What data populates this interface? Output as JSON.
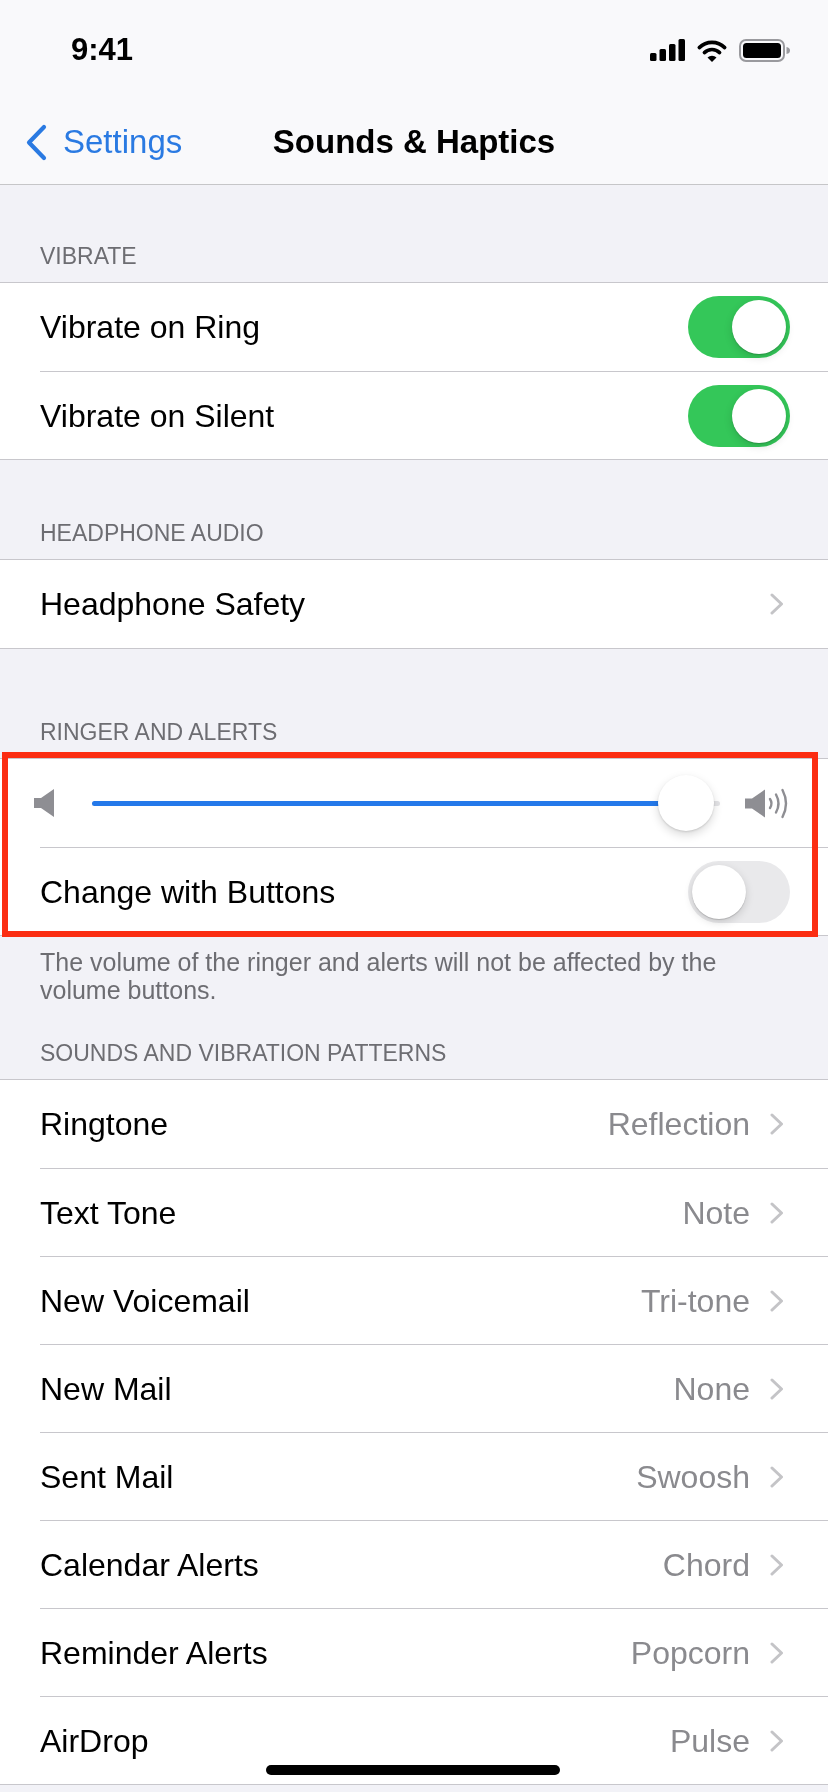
{
  "status_bar": {
    "time": "9:41"
  },
  "nav_bar": {
    "back": "Settings",
    "title": "Sounds & Haptics"
  },
  "sections": [
    {
      "header": "VIBRATE",
      "highlighted": false,
      "rows": [
        {
          "kind": "toggle",
          "label": "Vibrate on Ring",
          "on": true
        },
        {
          "kind": "toggle",
          "label": "Vibrate on Silent",
          "on": true
        }
      ]
    },
    {
      "header": "HEADPHONE AUDIO",
      "highlighted": false,
      "rows": [
        {
          "kind": "link",
          "label": "Headphone Safety"
        }
      ]
    },
    {
      "header": "RINGER AND ALERTS",
      "highlighted": true,
      "rows": [
        {
          "kind": "slider",
          "level": 0.99
        },
        {
          "kind": "toggle",
          "label": "Change with Buttons",
          "on": false
        }
      ],
      "footer": "The volume of the ringer and alerts will not be affected by the volume buttons."
    },
    {
      "header": "SOUNDS AND VIBRATION PATTERNS",
      "highlighted": false,
      "rows": [
        {
          "kind": "link",
          "label": "Ringtone",
          "value": "Reflection"
        },
        {
          "kind": "link",
          "label": "Text Tone",
          "value": "Note"
        },
        {
          "kind": "link",
          "label": "New Voicemail",
          "value": "Tri-tone"
        },
        {
          "kind": "link",
          "label": "New Mail",
          "value": "None"
        },
        {
          "kind": "link",
          "label": "Sent Mail",
          "value": "Swoosh"
        },
        {
          "kind": "link",
          "label": "Calendar Alerts",
          "value": "Chord"
        },
        {
          "kind": "link",
          "label": "Reminder Alerts",
          "value": "Popcorn"
        },
        {
          "kind": "link",
          "label": "AirDrop",
          "value": "Pulse"
        }
      ]
    }
  ]
}
